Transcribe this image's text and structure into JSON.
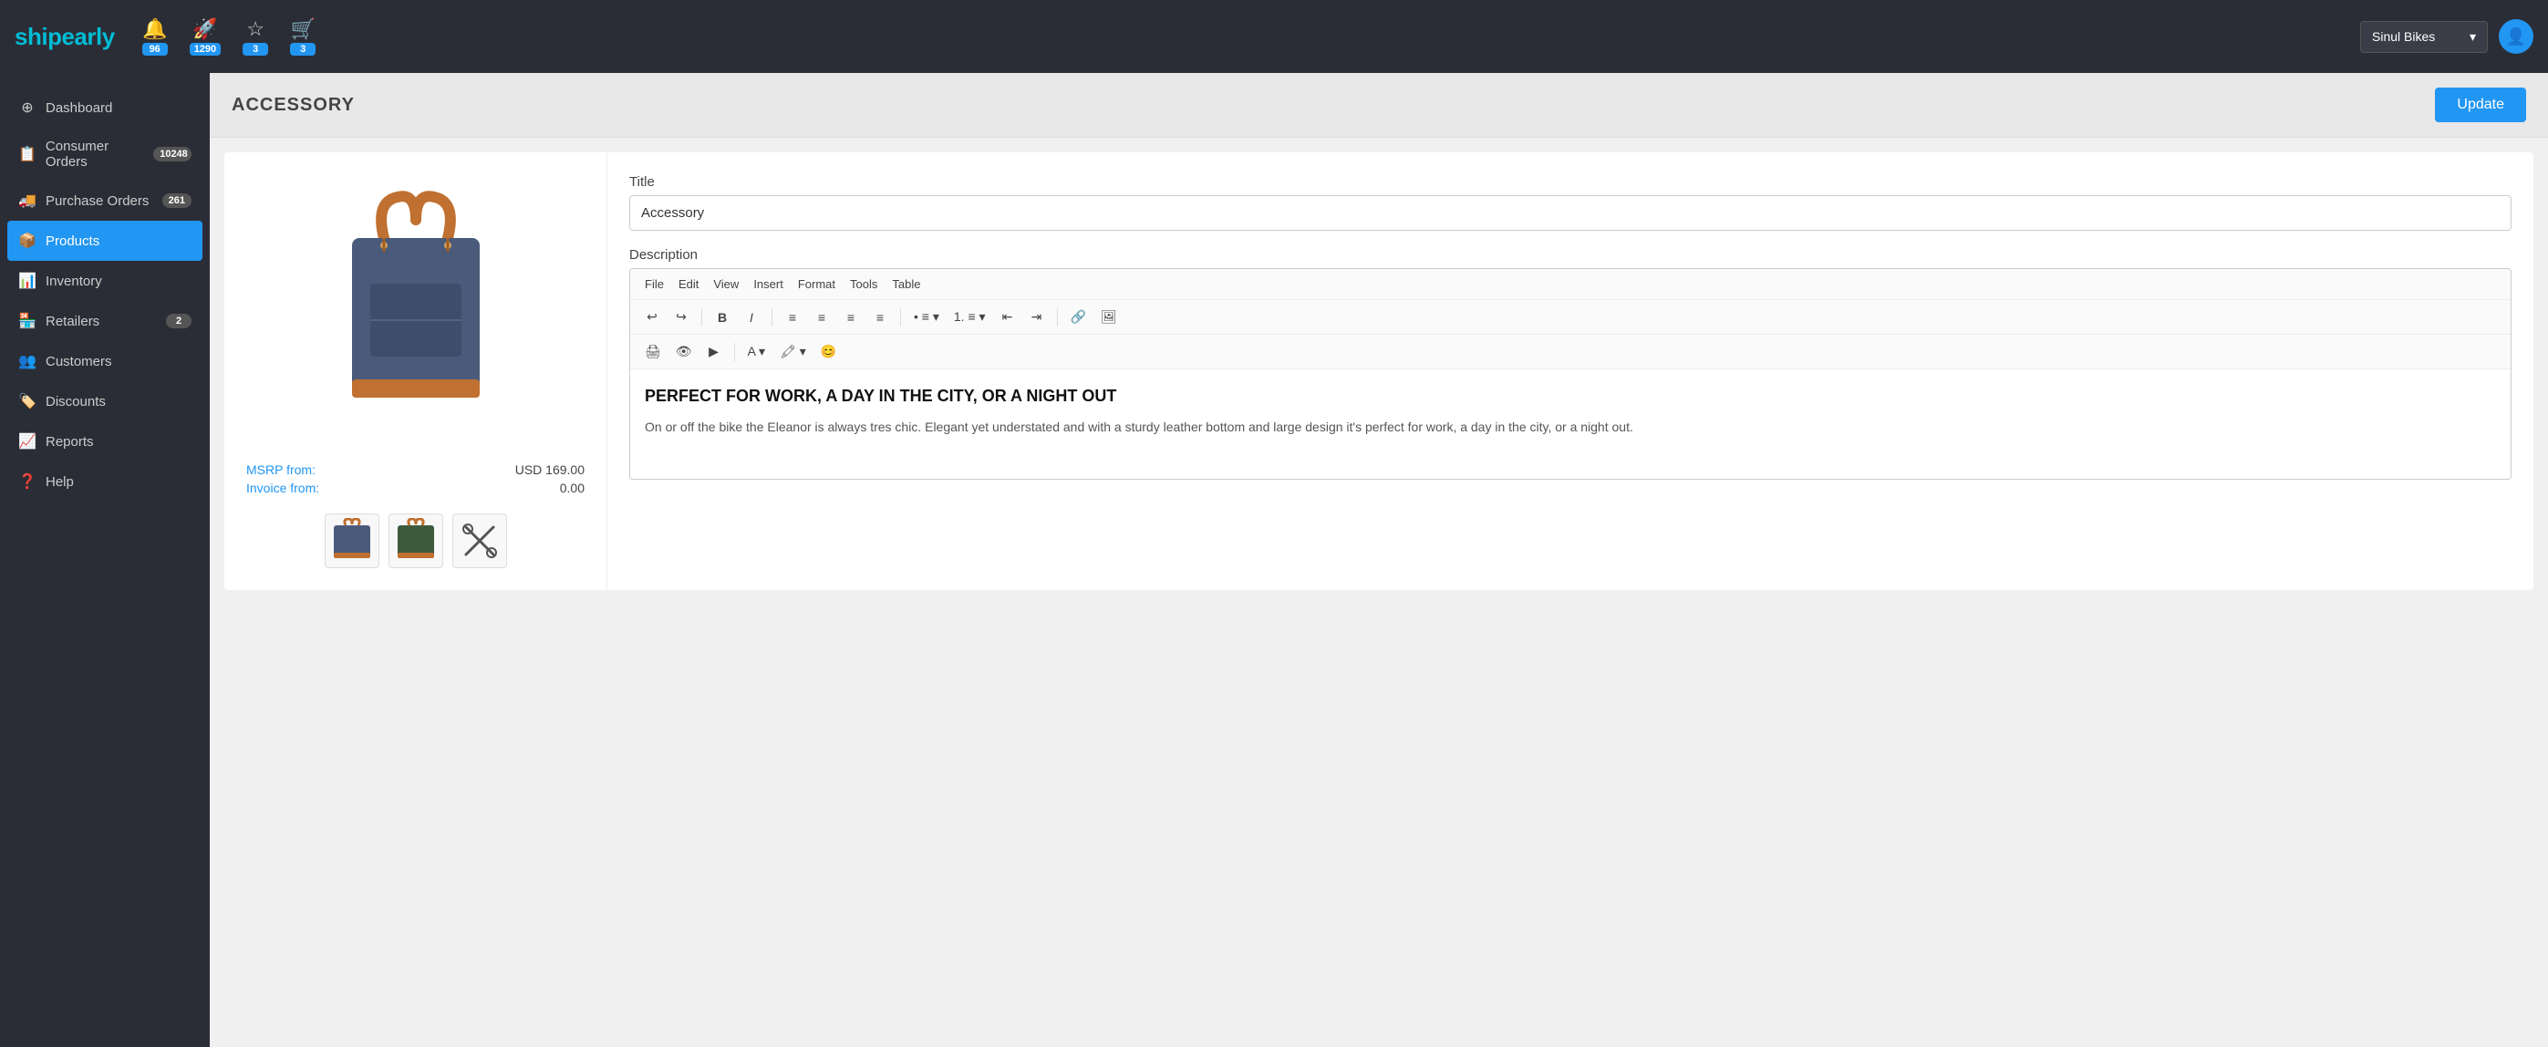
{
  "app": {
    "name_part1": "ship",
    "name_part2": "early"
  },
  "topnav": {
    "icons": [
      {
        "id": "bell-icon",
        "symbol": "🔔",
        "badge": "96"
      },
      {
        "id": "rocket-icon",
        "symbol": "🚀",
        "badge": "1290"
      },
      {
        "id": "star-icon",
        "symbol": "☆",
        "badge": "3"
      },
      {
        "id": "cart-icon",
        "symbol": "🛒",
        "badge": "3"
      }
    ],
    "store_name": "Sinul Bikes",
    "store_dropdown_arrow": "▾"
  },
  "sidebar": {
    "items": [
      {
        "id": "dashboard",
        "label": "Dashboard",
        "icon": "⊕",
        "badge": null
      },
      {
        "id": "consumer-orders",
        "label": "Consumer Orders",
        "icon": "📋",
        "badge": "10248"
      },
      {
        "id": "purchase-orders",
        "label": "Purchase Orders",
        "icon": "🚚",
        "badge": "261"
      },
      {
        "id": "products",
        "label": "Products",
        "icon": "📦",
        "badge": null,
        "active": true
      },
      {
        "id": "inventory",
        "label": "Inventory",
        "icon": "📊",
        "badge": null
      },
      {
        "id": "retailers",
        "label": "Retailers",
        "icon": "🏪",
        "badge": "2"
      },
      {
        "id": "customers",
        "label": "Customers",
        "icon": "👥",
        "badge": null
      },
      {
        "id": "discounts",
        "label": "Discounts",
        "icon": "🏷️",
        "badge": null
      },
      {
        "id": "reports",
        "label": "Reports",
        "icon": "📈",
        "badge": null
      },
      {
        "id": "help",
        "label": "Help",
        "icon": "❓",
        "badge": null
      }
    ]
  },
  "page": {
    "title": "ACCESSORY",
    "update_button": "Update"
  },
  "product": {
    "title_label": "Title",
    "title_value": "Accessory",
    "description_label": "Description",
    "msrp_label": "MSRP from:",
    "msrp_value": "USD 169.00",
    "invoice_label": "Invoice from:",
    "invoice_value": "0.00"
  },
  "editor": {
    "menu_items": [
      "File",
      "Edit",
      "View",
      "Insert",
      "Format",
      "Tools",
      "Table"
    ],
    "content_heading": "PERFECT FOR WORK, A DAY IN THE CITY, OR A NIGHT OUT",
    "content_body": "On or off the bike the Eleanor is always tres chic. Elegant yet understated and with a sturdy leather bottom and large design it's perfect for work, a day in the city, or a night out."
  }
}
